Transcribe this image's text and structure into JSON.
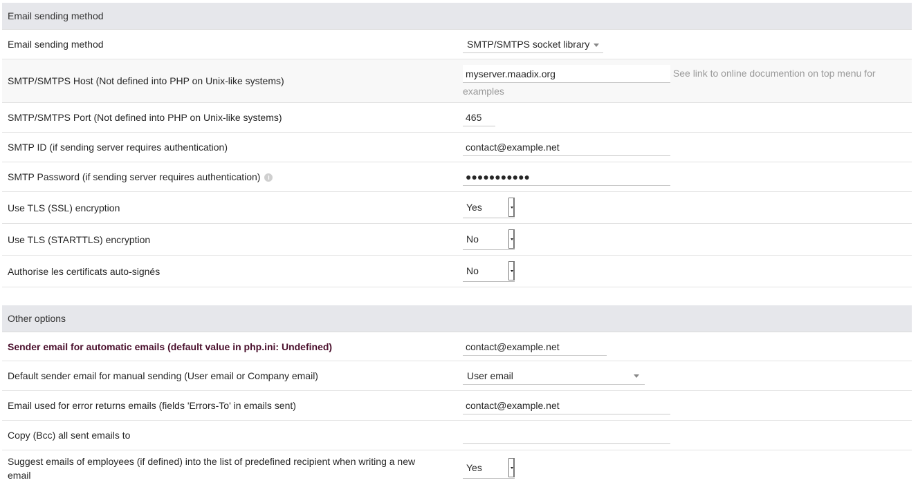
{
  "email_section": {
    "title": "Email sending method",
    "rows": {
      "method": {
        "label": "Email sending method",
        "value": "SMTP/SMTPS socket library"
      },
      "host": {
        "label": "SMTP/SMTPS Host (Not defined into PHP on Unix-like systems)",
        "value": "myserver.maadix.org",
        "hint": "See link to online documention on top menu for examples"
      },
      "port": {
        "label": "SMTP/SMTPS Port (Not defined into PHP on Unix-like systems)",
        "value": "465"
      },
      "smtp_id": {
        "label": "SMTP ID (if sending server requires authentication)",
        "value": "contact@example.net"
      },
      "smtp_password": {
        "label": "SMTP Password (if sending server requires authentication)",
        "value": "●●●●●●●●●●●",
        "icon": "info-icon"
      },
      "tls_ssl": {
        "label": "Use TLS (SSL) encryption",
        "value": "Yes"
      },
      "tls_starttls": {
        "label": "Use TLS (STARTTLS) encryption",
        "value": "No"
      },
      "self_signed": {
        "label": "Authorise les certificats auto-signés",
        "value": "No"
      }
    }
  },
  "other_section": {
    "title": "Other options",
    "rows": {
      "sender_auto": {
        "label": "Sender email for automatic emails (default value in php.ini: Undefined)",
        "value": "contact@example.net"
      },
      "sender_manual": {
        "label": "Default sender email for manual sending (User email or Company email)",
        "value": "User email"
      },
      "errors_to": {
        "label": "Email used for error returns emails (fields 'Errors-To' in emails sent)",
        "value": "contact@example.net"
      },
      "bcc": {
        "label": "Copy (Bcc) all sent emails to",
        "value": ""
      },
      "suggest_employees": {
        "label": "Suggest emails of employees (if defined) into the list of predefined recipient when writing a new email",
        "value": "Yes"
      }
    }
  }
}
